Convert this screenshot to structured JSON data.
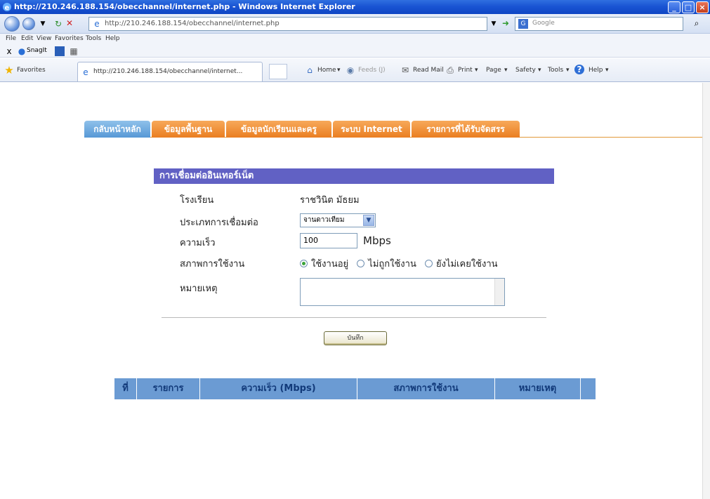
{
  "window": {
    "title": "http://210.246.188.154/obecchannel/internet.php - Windows Internet Explorer"
  },
  "address_bar": {
    "url": "http://210.246.188.154/obecchannel/internet.php",
    "search_placeholder": "Google"
  },
  "menu": {
    "items": [
      "File",
      "Edit",
      "View",
      "Favorites",
      "Tools",
      "Help"
    ]
  },
  "links_bar": {
    "items": [
      "SnagIt"
    ]
  },
  "favorites_bar": {
    "favorites_label": "Favorites",
    "tab_title": "http://210.246.188.154/obecchannel/internet...",
    "commands": {
      "home": "Home",
      "feeds": "Feeds (J)",
      "read_mail": "Read Mail",
      "print": "Print",
      "page": "Page",
      "safety": "Safety",
      "tools": "Tools",
      "help": "Help"
    }
  },
  "nav_tabs": [
    {
      "label": "กลับหน้าหลัก",
      "active": true
    },
    {
      "label": "ข้อมูลพื้นฐาน",
      "active": false
    },
    {
      "label": "ข้อมูลนักเรียนและครู",
      "active": false
    },
    {
      "label": "ระบบ Internet",
      "active": false
    },
    {
      "label": "รายการที่ได้รับจัดสรร",
      "active": false
    }
  ],
  "form": {
    "header": "การเชื่อมต่ออินเทอร์เน็ต",
    "school_label": "โรงเรียน",
    "school_value": "ราชวินิต มัธยม",
    "connection_type_label": "ประเภทการเชื่อมต่อ",
    "connection_type_value": "จานดาวเทียม",
    "speed_label": "ความเร็ว",
    "speed_value": "100",
    "speed_unit": "Mbps",
    "status_label": "สภาพการใช้งาน",
    "status_options": [
      "ใช้งานอยู่",
      "ไม่ถูกใช้งาน",
      "ยังไม่เคยใช้งาน"
    ],
    "status_selected": 0,
    "note_label": "หมายเหตุ",
    "save_button": "บันทึก"
  },
  "table": {
    "headers": [
      "ที่",
      "รายการ",
      "ความเร็ว (Mbps)",
      "สภาพการใช้งาน",
      "หมายเหตุ"
    ]
  },
  "colors": {
    "tab_orange": "#ea7e21",
    "tab_active_blue": "#5798d6",
    "section_header": "#6161c4",
    "table_header": "#6b9bd3"
  }
}
